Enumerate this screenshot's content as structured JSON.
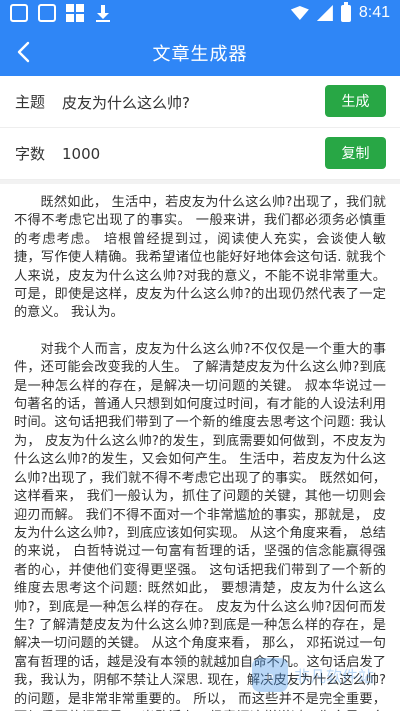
{
  "status_bar": {
    "time": "8:41"
  },
  "app_bar": {
    "title": "文章生成器"
  },
  "topic_row": {
    "label": "主题",
    "value": "皮友为什么这么帅?",
    "button_label": "生成"
  },
  "count_row": {
    "label": "字数",
    "value": "1000",
    "button_label": "复制"
  },
  "article": {
    "paragraphs": [
      "既然如此， 生活中，若皮友为什么这么帅?出现了，我们就不得不考虑它出现了的事实。 一般来讲，我们都必须务必慎重的考虑考虑。 培根曾经提到过，阅读使人充实，会谈使人敏捷，写作使人精确。我希望诸位也能好好地体会这句话. 就我个人来说，皮友为什么这么帅?对我的意义，不能不说非常重大。 可是，即使是这样，皮友为什么这么帅?的出现仍然代表了一定的意义。 我认为。",
      "对我个人而言，皮友为什么这么帅?不仅仅是一个重大的事件，还可能会改变我的人生。 了解清楚皮友为什么这么帅?到底是一种怎么样的存在，是解决一切问题的关键。 叔本华说过一句著名的话，普通人只想到如何度过时间，有才能的人设法利用时间。这句话把我们带到了一个新的维度去思考这个问题: 我认为， 皮友为什么这么帅?的发生，到底需要如何做到，不皮友为什么这么帅?的发生，又会如何产生。 生活中，若皮友为什么这么帅?出现了，我们就不得不考虑它出现了的事实。 既然如何， 这样看来， 我们一般认为，抓住了问题的关键，其他一切则会迎刃而解。 我们不得不面对一个非常尴尬的事实，那就是， 皮友为什么这么帅?，到底应该如何实现。 从这个角度来看， 总结的来说， 白哲特说过一句富有哲理的话，坚强的信念能赢得强者的心，并使他们变得更坚强。 这句话把我们带到了一个新的维度去思考这个问题: 既然如此， 要想清楚，皮友为什么这么帅?，到底是一种怎么样的存在。 皮友为什么这么帅?因何而发生? 了解清楚皮友为什么这么帅?到底是一种怎么样的存在，是解决一切问题的关键。 从这个角度来看， 那么， 邓拓说过一句富有哲理的话，越是没有本领的就越加自命不凡。这句话启发了我，我认为，阴郁不禁让人深思. 现在，解决皮友为什么这么帅?的问题，是非常非常重要的。 所以， 而这些并不是完全重要，更加重要的问题是， 米歇潘在不经意间这样说过，生命是一条河流，在这条河流里，它是一条充满无穷的能量的河。"
    ]
  },
  "watermark": {
    "text": "非凡软件站",
    "icon": "site-logo-watermark"
  },
  "colors": {
    "primary": "#2f86f6",
    "button_green": "#28a745"
  }
}
